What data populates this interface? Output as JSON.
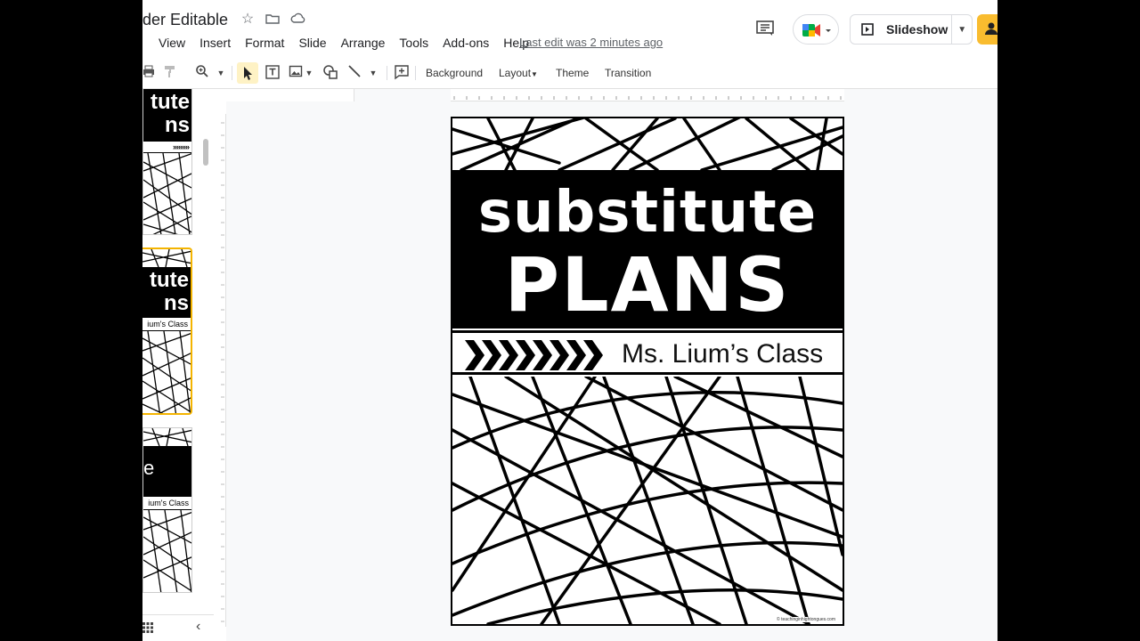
{
  "titlebar": {
    "doc_title": "der Editable",
    "last_edit": "Last edit was 2 minutes ago"
  },
  "menu": {
    "items": [
      "View",
      "Insert",
      "Format",
      "Slide",
      "Arrange",
      "Tools",
      "Add-ons",
      "Help"
    ]
  },
  "header_buttons": {
    "slideshow_label": "Slideshow"
  },
  "toolbar": {
    "background_label": "Background",
    "layout_label": "Layout",
    "theme_label": "Theme",
    "transition_label": "Transition"
  },
  "filmstrip": {
    "thumb1_title": "tute",
    "thumb1_subtitle": "ns",
    "thumb2_title": "tute",
    "thumb2_subtitle": "ns",
    "thumb2_strip": "ium's Class",
    "thumb3_band": "e",
    "thumb3_strip": "ium's Class"
  },
  "slide": {
    "title_line1": "substitute",
    "title_line2": "PLANS",
    "class_name": "Ms. Lium’s Class",
    "credit": "© teachinginhightongues.com"
  },
  "colors": {
    "accent_yellow": "#f4b400",
    "share_button": "#f9bc2f",
    "select_highlight": "#fef2c5"
  }
}
